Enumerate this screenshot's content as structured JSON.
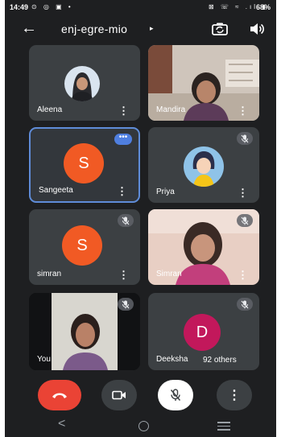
{
  "status_bar": {
    "time": "14:49",
    "left_icons": "⊙ ◎ ▣ •",
    "right_icons": "⊠ ☏ ≈ .ıl ▮",
    "battery": "68%"
  },
  "meeting": {
    "code": "enj-egre-mio",
    "caret": "▸"
  },
  "icons": {
    "back": "arrow-back-icon",
    "switch_camera": "switch-camera-icon",
    "speaker": "speaker-icon",
    "mute": "mic-off-icon",
    "more": "more-vert-icon"
  },
  "colors": {
    "background": "#1e1f21",
    "tile": "#3c4043",
    "accent_blue": "#4f7fe0",
    "end_call": "#ea4335",
    "avatar_orange": "#f15a24",
    "avatar_pink": "#c2185b"
  },
  "participants": [
    {
      "name": "Aleena",
      "type": "photo-avatar",
      "muted": false
    },
    {
      "name": "Mandira",
      "type": "video",
      "muted": false
    },
    {
      "name": "Sangeeta",
      "type": "letter",
      "letter": "S",
      "speaking": true,
      "speaking_dots": "•••"
    },
    {
      "name": "Priya",
      "type": "photo-avatar",
      "muted": true
    },
    {
      "name": "simran",
      "type": "letter",
      "letter": "S",
      "muted": true
    },
    {
      "name": "Simran",
      "type": "video",
      "muted": true
    },
    {
      "name": "You",
      "type": "video",
      "muted": true
    },
    {
      "name": "Deeksha",
      "type": "letter",
      "letter": "D",
      "muted": true,
      "others": "92 others"
    }
  ],
  "controls": {
    "end_call": "end-call-icon",
    "camera": "videocam-icon",
    "mic": "mic-off-icon",
    "more": "⋮"
  },
  "navbar": {
    "back": "<"
  }
}
